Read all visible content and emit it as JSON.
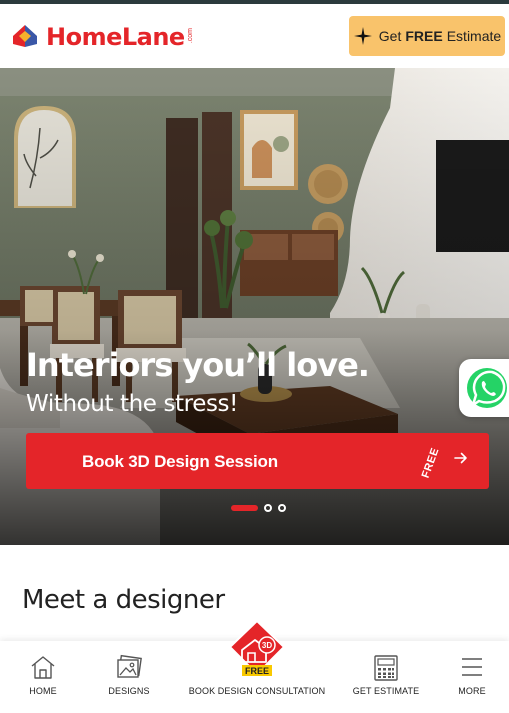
{
  "header": {
    "brand": "HomeLane",
    "brand_suffix": ".com",
    "estimate_prefix": "Get",
    "estimate_bold": "FREE",
    "estimate_suffix": "Estimate"
  },
  "hero": {
    "title": "Interiors you’ll love.",
    "subtitle": "Without the stress!",
    "cta_label": "Book 3D Design Session",
    "cta_badge": "FREE",
    "carousel_pages": 3,
    "carousel_active": 1
  },
  "section": {
    "title": "Meet a designer"
  },
  "bottom_nav": {
    "items": [
      {
        "label": "HOME",
        "icon": "home-icon"
      },
      {
        "label": "DESIGNS",
        "icon": "gallery-icon"
      },
      {
        "label": "BOOK DESIGN CONSULTATION",
        "icon": "3d-house-icon",
        "badge": "FREE",
        "badge_icon": "3D"
      },
      {
        "label": "GET ESTIMATE",
        "icon": "calculator-icon"
      },
      {
        "label": "MORE",
        "icon": "menu-icon"
      }
    ]
  },
  "colors": {
    "brand_red": "#e42529",
    "estimate_yellow": "#f9c36b",
    "whatsapp_green": "#25d366"
  }
}
